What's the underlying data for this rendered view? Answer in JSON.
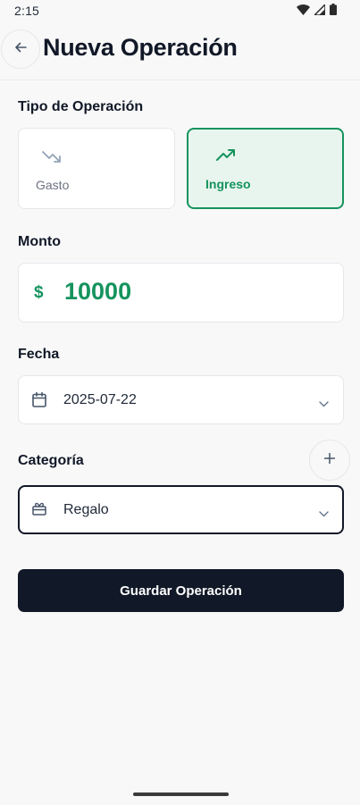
{
  "status_bar": {
    "time": "2:15",
    "icons": [
      "wifi-icon",
      "signal-icon",
      "battery-icon"
    ]
  },
  "header": {
    "back_icon": "arrow-left-icon",
    "title": "Nueva Operación"
  },
  "operation_type": {
    "label": "Tipo de Operación",
    "options": [
      {
        "label": "Gasto",
        "icon": "trending-down-icon",
        "selected": false
      },
      {
        "label": "Ingreso",
        "icon": "trending-up-icon",
        "selected": true
      }
    ]
  },
  "amount": {
    "label": "Monto",
    "currency_symbol": "$",
    "value": "10000"
  },
  "date": {
    "label": "Fecha",
    "icon": "calendar-icon",
    "value": "2025-07-22"
  },
  "category": {
    "label": "Categoría",
    "icon": "gift-icon",
    "value": "Regalo",
    "add_icon": "plus-icon"
  },
  "save_button": {
    "label": "Guardar Operación"
  },
  "colors": {
    "accent_green": "#15935e",
    "dark": "#111827",
    "muted": "#6b7280"
  }
}
